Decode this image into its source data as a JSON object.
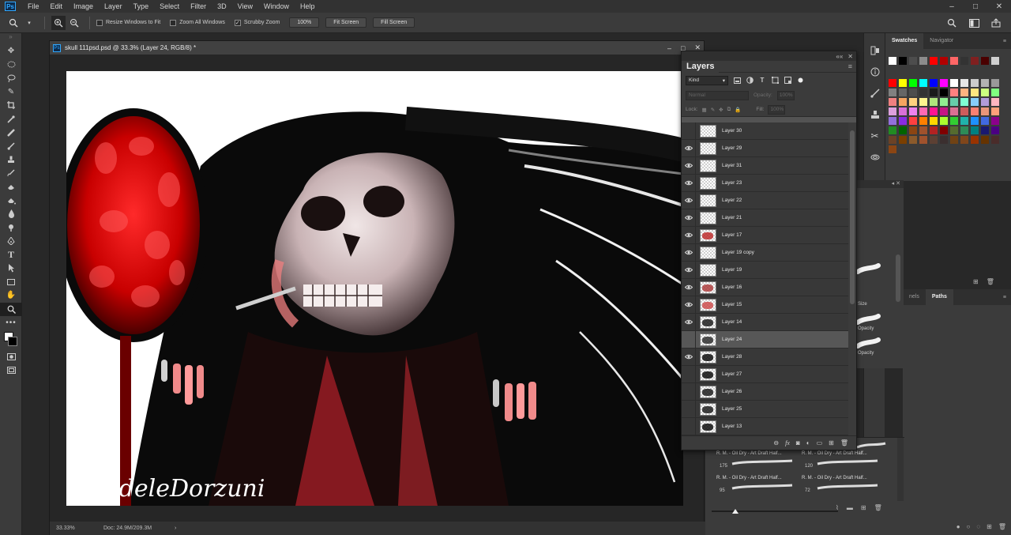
{
  "app": {
    "logo": "Ps"
  },
  "menu": [
    "File",
    "Edit",
    "Image",
    "Layer",
    "Type",
    "Select",
    "Filter",
    "3D",
    "View",
    "Window",
    "Help"
  ],
  "options": {
    "resize_windows": "Resize Windows to Fit",
    "zoom_all": "Zoom All Windows",
    "scrubby_zoom": "Scrubby Zoom",
    "zoom_value": "100%",
    "fit_screen": "Fit Screen",
    "fill_screen": "Fill Screen",
    "scrubby_checked": "✓"
  },
  "document": {
    "title": "skull 111psd.psd @ 33.3% (Layer 24, RGB/8) *",
    "zoom": "33.33%",
    "doc_size": "Doc: 24.9M/209.3M",
    "signature": "AdeleDorzuni"
  },
  "swatches_panel": {
    "tabs": [
      "Swatches",
      "Navigator"
    ]
  },
  "paths_panel": {
    "tabs": [
      "nels",
      "Paths"
    ]
  },
  "layers_panel": {
    "tab": "Layers",
    "filter_kind": "Kind",
    "blend_mode": "Normal",
    "opacity_label": "Opacity:",
    "opacity_value": "100%",
    "lock_label": "Lock:",
    "fill_label": "Fill:",
    "fill_value": "100%",
    "layers": [
      {
        "name": "Layer 30",
        "visible": false,
        "selected": false
      },
      {
        "name": "Layer 29",
        "visible": true,
        "selected": false
      },
      {
        "name": "Layer 31",
        "visible": true,
        "selected": false
      },
      {
        "name": "Layer 23",
        "visible": true,
        "selected": false
      },
      {
        "name": "Layer 22",
        "visible": true,
        "selected": false
      },
      {
        "name": "Layer 21",
        "visible": true,
        "selected": false
      },
      {
        "name": "Layer 17",
        "visible": true,
        "selected": false
      },
      {
        "name": "Layer 19 copy",
        "visible": true,
        "selected": false
      },
      {
        "name": "Layer 19",
        "visible": true,
        "selected": false
      },
      {
        "name": "Layer 16",
        "visible": true,
        "selected": false
      },
      {
        "name": "Layer 15",
        "visible": true,
        "selected": false
      },
      {
        "name": "Layer 14",
        "visible": true,
        "selected": false
      },
      {
        "name": "Layer 24",
        "visible": false,
        "selected": true
      },
      {
        "name": "Layer 28",
        "visible": true,
        "selected": false
      },
      {
        "name": "Layer 27",
        "visible": false,
        "selected": false
      },
      {
        "name": "Layer 26",
        "visible": false,
        "selected": false
      },
      {
        "name": "Layer 25",
        "visible": false,
        "selected": false
      },
      {
        "name": "Layer 13",
        "visible": false,
        "selected": false
      }
    ]
  },
  "brush_side_labels": [
    "Size",
    "Opacity",
    "Opacity"
  ],
  "brush_presets": [
    {
      "name": "R. M. - Oil Dry - Art Draft Half...",
      "size": ""
    },
    {
      "name": "R. M. - Oil Dry - Art Draft Half...",
      "size": ""
    },
    {
      "name": "R. M. - Oil Dry - Art Draft Half...",
      "size": "175"
    },
    {
      "name": "R. M. - Oil Dry - Art Draft Half...",
      "size": "120"
    },
    {
      "name": "",
      "size": "95"
    },
    {
      "name": "",
      "size": "72"
    }
  ],
  "colors": {
    "accent": "#31a8ff",
    "panel": "#3b3b3b",
    "selected_layer": "#575757"
  }
}
